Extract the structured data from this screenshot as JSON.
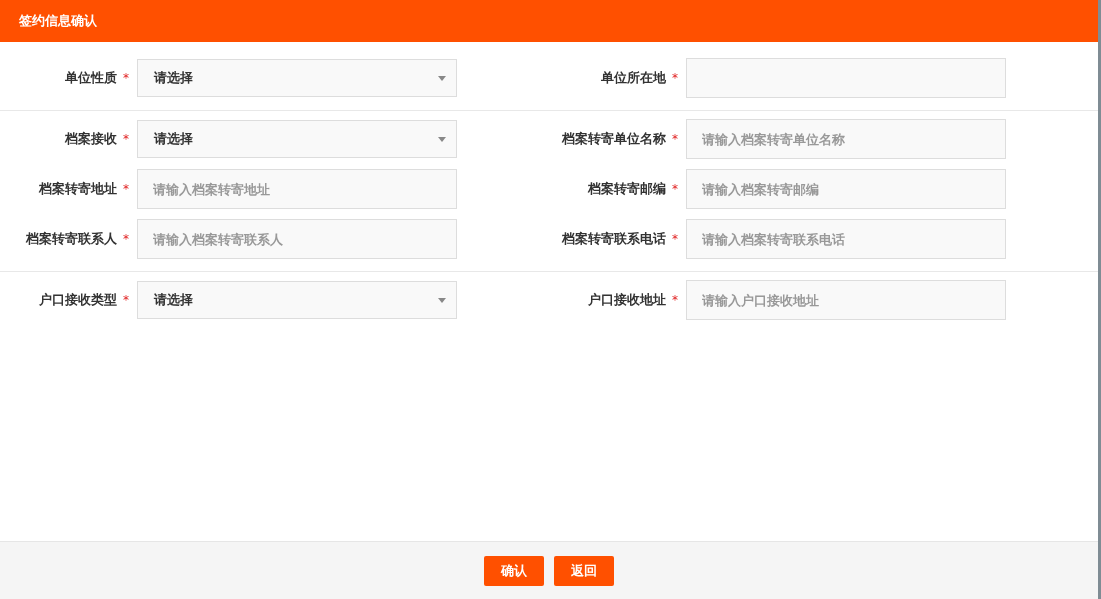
{
  "dialog": {
    "title": "签约信息确认"
  },
  "sections": [
    {
      "rows": [
        [
          {
            "label": "单位性质",
            "required_mark": "*",
            "kind": "select",
            "value": "请选择"
          },
          {
            "label": "单位所在地",
            "required_mark": "*",
            "kind": "input"
          }
        ]
      ]
    },
    {
      "rows": [
        [
          {
            "label": "档案接收",
            "required_mark": "*",
            "kind": "select",
            "value": "请选择"
          },
          {
            "label": "档案转寄单位名称",
            "required_mark": "*",
            "kind": "input",
            "placeholder": "请输入档案转寄单位名称"
          }
        ],
        [
          {
            "label": "档案转寄地址",
            "required_mark": "*",
            "kind": "input",
            "placeholder": "请输入档案转寄地址"
          },
          {
            "label": "档案转寄邮编",
            "required_mark": "*",
            "kind": "input",
            "placeholder": "请输入档案转寄邮编"
          }
        ],
        [
          {
            "label": "档案转寄联系人",
            "required_mark": "*",
            "kind": "input",
            "placeholder": "请输入档案转寄联系人"
          },
          {
            "label": "档案转寄联系电话",
            "required_mark": "*",
            "kind": "input",
            "placeholder": "请输入档案转寄联系电话"
          }
        ]
      ]
    },
    {
      "rows": [
        [
          {
            "label": "户口接收类型",
            "required_mark": "*",
            "kind": "select",
            "value": "请选择"
          },
          {
            "label": "户口接收地址",
            "required_mark": "*",
            "kind": "input",
            "placeholder": "请输入户口接收地址"
          }
        ]
      ]
    }
  ],
  "buttons": [
    {
      "label": "确认"
    },
    {
      "label": "返回"
    }
  ]
}
